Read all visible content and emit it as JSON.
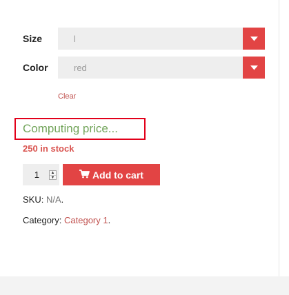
{
  "variations": {
    "size": {
      "label": "Size",
      "value": "l"
    },
    "color": {
      "label": "Color",
      "value": "red"
    },
    "clear_label": "Clear"
  },
  "price": {
    "text": "Computing price..."
  },
  "stock": {
    "text": "250 in stock"
  },
  "cart": {
    "quantity": "1",
    "add_label": "Add to cart"
  },
  "meta": {
    "sku_label": "SKU:",
    "sku_value": "N/A",
    "sku_suffix": ".",
    "category_label": "Category:",
    "category_value": "Category 1",
    "category_suffix": "."
  },
  "colors": {
    "accent": "#e24444",
    "price_text": "#72a45a",
    "highlight_border": "#e2001a",
    "link": "#c0504d"
  },
  "icons": {
    "dropdown": "chevron-down-icon",
    "cart": "cart-icon"
  }
}
